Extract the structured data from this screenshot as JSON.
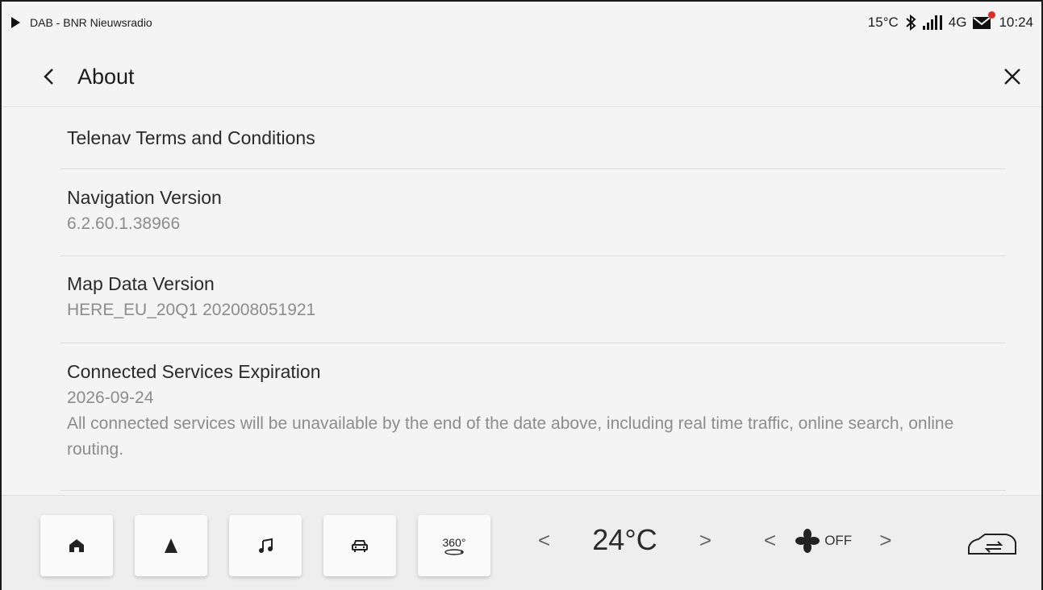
{
  "status": {
    "source": "DAB - BNR Nieuwsradio",
    "temperature": "15°C",
    "network": "4G",
    "time": "10:24"
  },
  "header": {
    "title": "About"
  },
  "items": [
    {
      "label": "Telenav Terms and Conditions"
    },
    {
      "label": "Navigation Version",
      "value": "6.2.60.1.38966"
    },
    {
      "label": "Map Data Version",
      "value": "HERE_EU_20Q1 202008051921"
    },
    {
      "label": "Connected Services Expiration",
      "value": "2026-09-24",
      "description": "All connected services will be unavailable by the end of the date above, including real time traffic, online search, online routing."
    }
  ],
  "dock": {
    "view360_label": "360°",
    "temperature": "24°C",
    "fan_state": "OFF"
  },
  "colors": {
    "background": "#f4f4f4",
    "secondary_text": "#8c8c8c",
    "mail_badge": "#e12a2a"
  }
}
